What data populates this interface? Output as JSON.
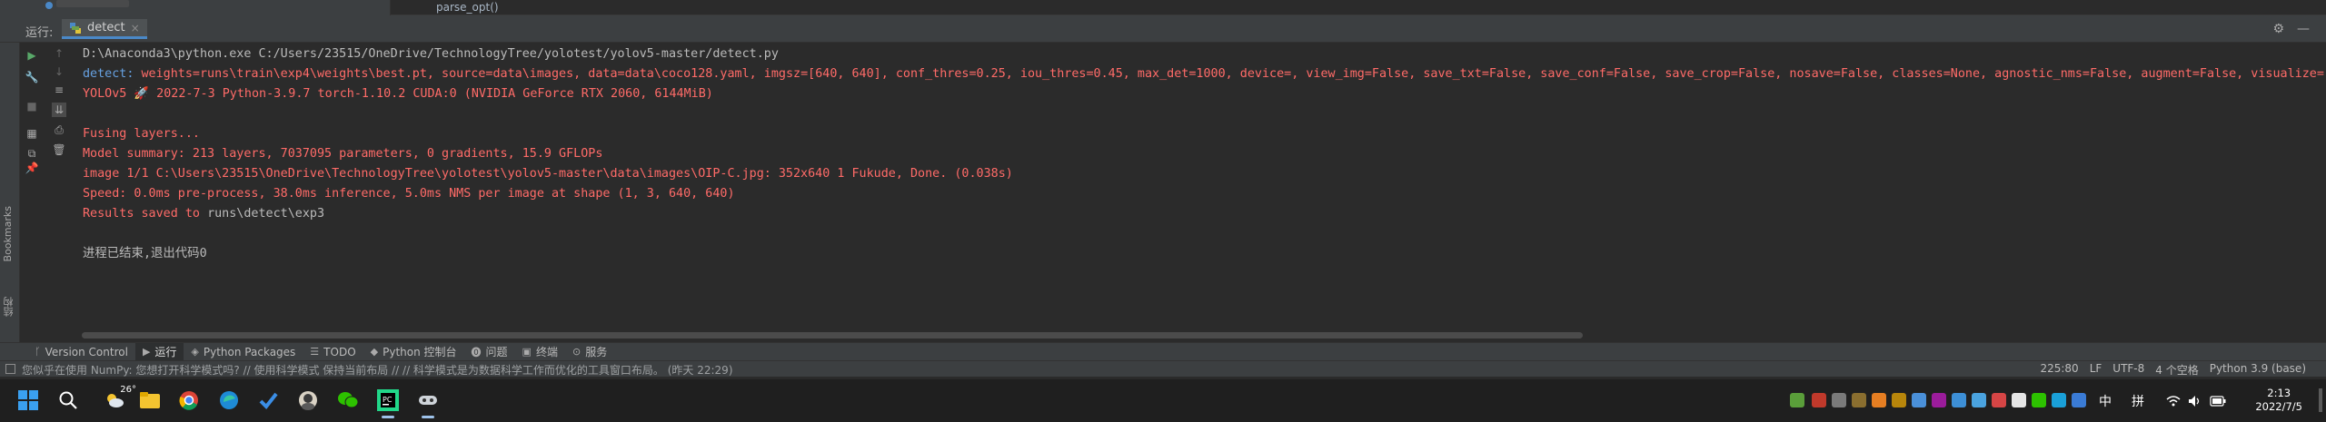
{
  "editor": {
    "visible_function": "parse_opt()"
  },
  "run_window": {
    "label": "运行:",
    "tab_label": "detect",
    "tab_close": "×"
  },
  "side_labels": {
    "bookmarks": "Bookmarks",
    "structure": "结构"
  },
  "console": {
    "lines": [
      {
        "color": "white",
        "text": "D:\\Anaconda3\\python.exe C:/Users/23515/OneDrive/TechnologyTree/yolotest/yolov5-master/detect.py"
      },
      {
        "color": "mixed",
        "prefix": "detect: ",
        "text": "weights=runs\\train\\exp4\\weights\\best.pt, source=data\\images, data=data\\coco128.yaml, imgsz=[640, 640], conf_thres=0.25, iou_thres=0.45, max_det=1000, device=, view_img=False, save_txt=False, save_conf=False, save_crop=False, nosave=False, classes=None, agnostic_nms=False, augment=False, visualize="
      },
      {
        "color": "red",
        "text": "YOLOv5 🚀 2022-7-3 Python-3.9.7 torch-1.10.2 CUDA:0 (NVIDIA GeForce RTX 2060, 6144MiB)"
      },
      {
        "color": "red",
        "text": ""
      },
      {
        "color": "red",
        "text": "Fusing layers... "
      },
      {
        "color": "red",
        "text": "Model summary: 213 layers, 7037095 parameters, 0 gradients, 15.9 GFLOPs"
      },
      {
        "color": "red",
        "text": "image 1/1 C:\\Users\\23515\\OneDrive\\TechnologyTree\\yolotest\\yolov5-master\\data\\images\\OIP-C.jpg: 352x640 1 Fukude, Done. (0.038s)"
      },
      {
        "color": "red",
        "text": "Speed: 0.0ms pre-process, 38.0ms inference, 5.0ms NMS per image at shape (1, 3, 640, 640)"
      },
      {
        "color": "red",
        "prefix": "Results saved to ",
        "text": "runs\\detect\\exp3"
      },
      {
        "color": "white",
        "text": ""
      },
      {
        "color": "white",
        "text": "进程已结束,退出代码0"
      }
    ]
  },
  "tool_tabs": [
    {
      "label": "Version Control",
      "icon": "branch-icon"
    },
    {
      "label": "运行",
      "icon": "play-icon"
    },
    {
      "label": "Python Packages",
      "icon": "packages-icon"
    },
    {
      "label": "TODO",
      "icon": "list-icon"
    },
    {
      "label": "Python 控制台",
      "icon": "python-icon"
    },
    {
      "label": "问题",
      "icon": "warning-icon"
    },
    {
      "label": "终端",
      "icon": "terminal-icon"
    },
    {
      "label": "服务",
      "icon": "services-icon"
    }
  ],
  "status_bar": {
    "message": "您似乎在使用 NumPy: 您想打开科学模式吗? // 使用科学模式   保持当前布局 // // 科学模式是为数据科学工作而优化的工具窗口布局。 (昨天 22:29)",
    "position": "225:80",
    "line_sep": "LF",
    "encoding": "UTF-8",
    "indent": "4 个空格",
    "interpreter": "Python 3.9 (base)"
  },
  "taskbar": {
    "weather_temp": "26°",
    "ime_lang": "中",
    "ime_mode": "拼",
    "time": "2:13",
    "date": "2022/7/5"
  }
}
